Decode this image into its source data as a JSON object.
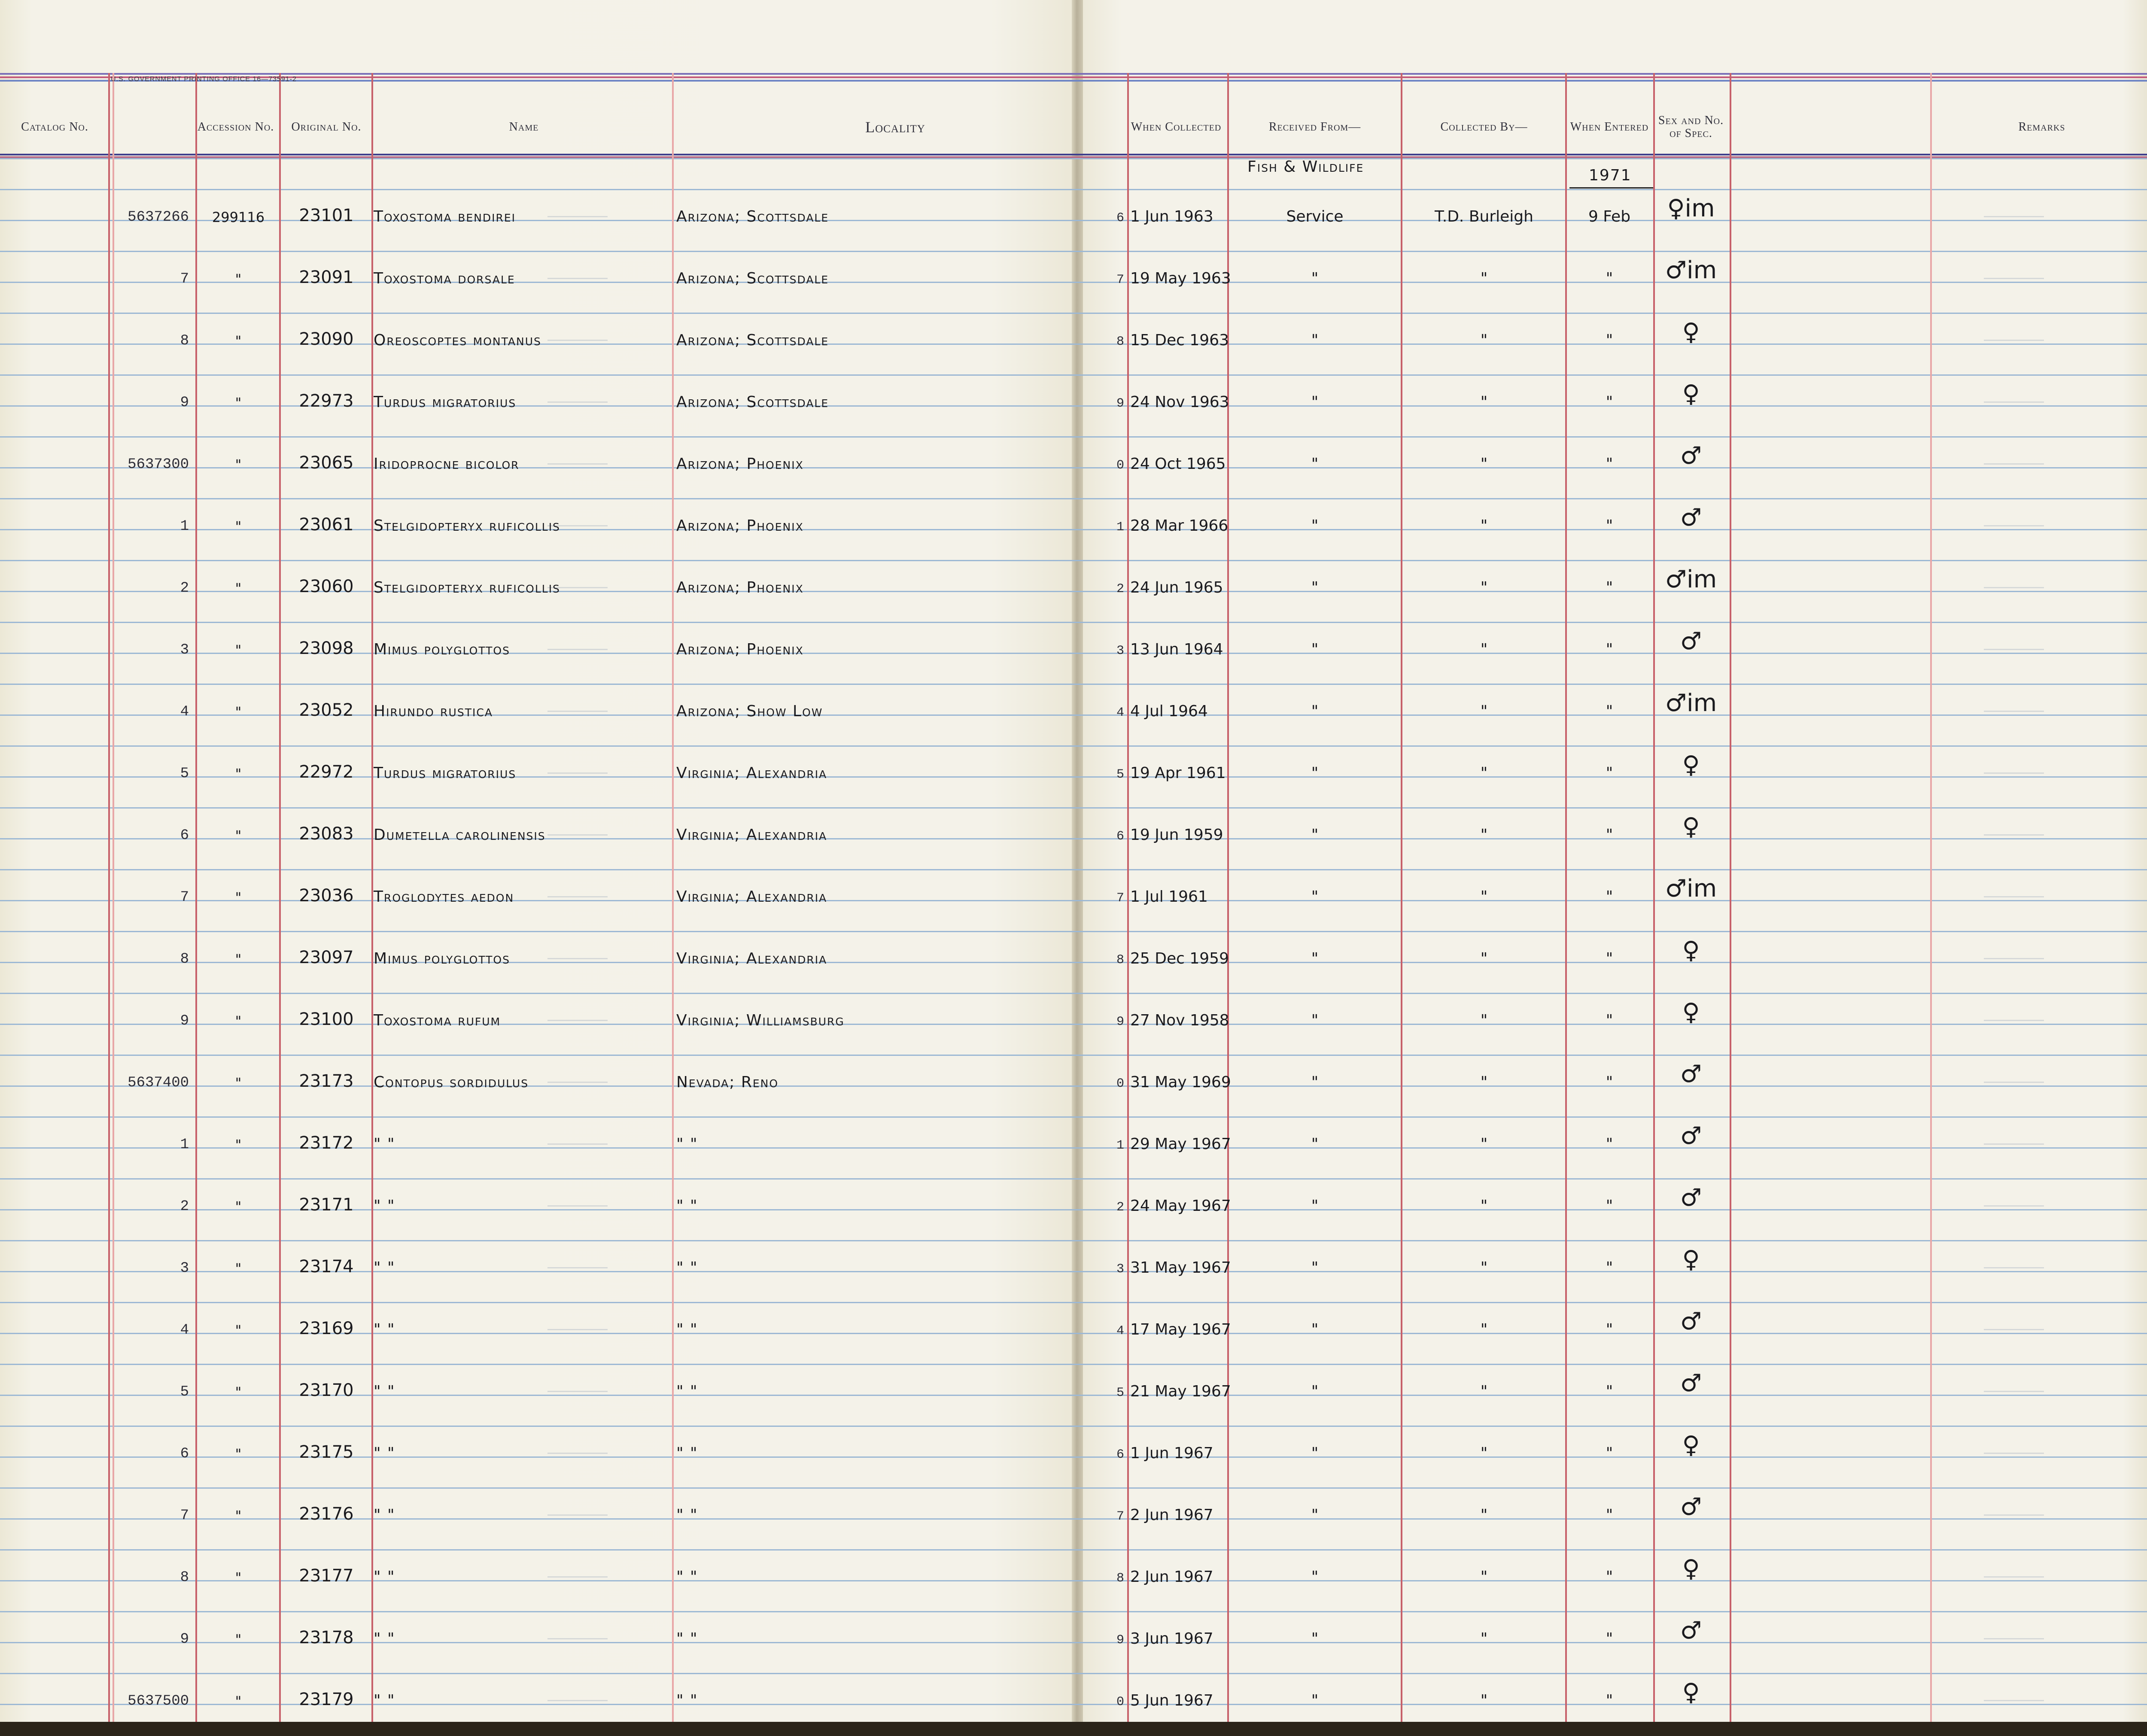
{
  "imprint": "U.S. GOVERNMENT PRINTING OFFICE    16—73591-2",
  "headers": {
    "catalog": "Catalog No.",
    "accession": "Accession No.",
    "original": "Original No.",
    "name": "Name",
    "locality": "Locality",
    "when_collected": "When Collected",
    "received_from": "Received From—",
    "collected_by": "Collected By—",
    "when_entered": "When Entered",
    "sex": "Sex and No. of Spec.",
    "remarks": "Remarks"
  },
  "top_annotations": {
    "received_from": "Fish & Wildlife",
    "entered_year": "1971"
  },
  "rows": [
    {
      "cat": "5637266",
      "acc": "299116",
      "orig": "23101",
      "name": "Toxostoma bendirei",
      "loc": "Arizona; Scottsdale",
      "num": "6",
      "date": "1 Jun 1963",
      "recv": "Service",
      "coll": "T.D. Burleigh",
      "ent": "9 Feb",
      "sex": "♀im"
    },
    {
      "cat": "7",
      "acc": "\"",
      "orig": "23091",
      "name": "Toxostoma dorsale",
      "loc": "Arizona; Scottsdale",
      "num": "7",
      "date": "19 May 1963",
      "recv": "\"",
      "coll": "\"",
      "ent": "\"",
      "sex": "♂im"
    },
    {
      "cat": "8",
      "acc": "\"",
      "orig": "23090",
      "name": "Oreoscoptes montanus",
      "loc": "Arizona; Scottsdale",
      "num": "8",
      "date": "15 Dec 1963",
      "recv": "\"",
      "coll": "\"",
      "ent": "\"",
      "sex": "♀"
    },
    {
      "cat": "9",
      "acc": "\"",
      "orig": "22973",
      "name": "Turdus migratorius",
      "loc": "Arizona; Scottsdale",
      "num": "9",
      "date": "24 Nov 1963",
      "recv": "\"",
      "coll": "\"",
      "ent": "\"",
      "sex": "♀"
    },
    {
      "cat": "5637300",
      "acc": "\"",
      "orig": "23065",
      "name": "Iridoprocne bicolor",
      "loc": "Arizona; Phoenix",
      "num": "0",
      "date": "24 Oct 1965",
      "recv": "\"",
      "coll": "\"",
      "ent": "\"",
      "sex": "♂"
    },
    {
      "cat": "1",
      "acc": "\"",
      "orig": "23061",
      "name": "Stelgidopteryx ruficollis",
      "loc": "Arizona; Phoenix",
      "num": "1",
      "date": "28 Mar 1966",
      "recv": "\"",
      "coll": "\"",
      "ent": "\"",
      "sex": "♂"
    },
    {
      "cat": "2",
      "acc": "\"",
      "orig": "23060",
      "name": "Stelgidopteryx ruficollis",
      "loc": "Arizona; Phoenix",
      "num": "2",
      "date": "24 Jun 1965",
      "recv": "\"",
      "coll": "\"",
      "ent": "\"",
      "sex": "♂im"
    },
    {
      "cat": "3",
      "acc": "\"",
      "orig": "23098",
      "name": "Mimus polyglottos",
      "loc": "Arizona; Phoenix",
      "num": "3",
      "date": "13 Jun 1964",
      "recv": "\"",
      "coll": "\"",
      "ent": "\"",
      "sex": "♂"
    },
    {
      "cat": "4",
      "acc": "\"",
      "orig": "23052",
      "name": "Hirundo rustica",
      "loc": "Arizona; Show Low",
      "num": "4",
      "date": "4 Jul 1964",
      "recv": "\"",
      "coll": "\"",
      "ent": "\"",
      "sex": "♂im"
    },
    {
      "cat": "5",
      "acc": "\"",
      "orig": "22972",
      "name": "Turdus migratorius",
      "loc": "Virginia; Alexandria",
      "num": "5",
      "date": "19 Apr 1961",
      "recv": "\"",
      "coll": "\"",
      "ent": "\"",
      "sex": "♀"
    },
    {
      "cat": "6",
      "acc": "\"",
      "orig": "23083",
      "name": "Dumetella carolinensis",
      "loc": "Virginia; Alexandria",
      "num": "6",
      "date": "19 Jun 1959",
      "recv": "\"",
      "coll": "\"",
      "ent": "\"",
      "sex": "♀"
    },
    {
      "cat": "7",
      "acc": "\"",
      "orig": "23036",
      "name": "Troglodytes aedon",
      "loc": "Virginia; Alexandria",
      "num": "7",
      "date": "1 Jul 1961",
      "recv": "\"",
      "coll": "\"",
      "ent": "\"",
      "sex": "♂im"
    },
    {
      "cat": "8",
      "acc": "\"",
      "orig": "23097",
      "name": "Mimus polyglottos",
      "loc": "Virginia; Alexandria",
      "num": "8",
      "date": "25 Dec 1959",
      "recv": "\"",
      "coll": "\"",
      "ent": "\"",
      "sex": "♀"
    },
    {
      "cat": "9",
      "acc": "\"",
      "orig": "23100",
      "name": "Toxostoma rufum",
      "loc": "Virginia; Williamsburg",
      "num": "9",
      "date": "27 Nov 1958",
      "recv": "\"",
      "coll": "\"",
      "ent": "\"",
      "sex": "♀"
    },
    {
      "cat": "5637400",
      "acc": "\"",
      "orig": "23173",
      "name": "Contopus sordidulus",
      "loc": "Nevada; Reno",
      "num": "0",
      "date": "31 May 1969",
      "recv": "\"",
      "coll": "\"",
      "ent": "\"",
      "sex": "♂"
    },
    {
      "cat": "1",
      "acc": "\"",
      "orig": "23172",
      "name": "\"  \"",
      "loc": "\"  \"",
      "num": "1",
      "date": "29 May 1967",
      "recv": "\"",
      "coll": "\"",
      "ent": "\"",
      "sex": "♂"
    },
    {
      "cat": "2",
      "acc": "\"",
      "orig": "23171",
      "name": "\"  \"",
      "loc": "\"  \"",
      "num": "2",
      "date": "24 May 1967",
      "recv": "\"",
      "coll": "\"",
      "ent": "\"",
      "sex": "♂"
    },
    {
      "cat": "3",
      "acc": "\"",
      "orig": "23174",
      "name": "\"  \"",
      "loc": "\"  \"",
      "num": "3",
      "date": "31 May 1967",
      "recv": "\"",
      "coll": "\"",
      "ent": "\"",
      "sex": "♀"
    },
    {
      "cat": "4",
      "acc": "\"",
      "orig": "23169",
      "name": "\"  \"",
      "loc": "\"  \"",
      "num": "4",
      "date": "17 May 1967",
      "recv": "\"",
      "coll": "\"",
      "ent": "\"",
      "sex": "♂"
    },
    {
      "cat": "5",
      "acc": "\"",
      "orig": "23170",
      "name": "\"  \"",
      "loc": "\"  \"",
      "num": "5",
      "date": "21 May 1967",
      "recv": "\"",
      "coll": "\"",
      "ent": "\"",
      "sex": "♂"
    },
    {
      "cat": "6",
      "acc": "\"",
      "orig": "23175",
      "name": "\"  \"",
      "loc": "\"  \"",
      "num": "6",
      "date": "1 Jun 1967",
      "recv": "\"",
      "coll": "\"",
      "ent": "\"",
      "sex": "♀"
    },
    {
      "cat": "7",
      "acc": "\"",
      "orig": "23176",
      "name": "\"  \"",
      "loc": "\"  \"",
      "num": "7",
      "date": "2 Jun 1967",
      "recv": "\"",
      "coll": "\"",
      "ent": "\"",
      "sex": "♂"
    },
    {
      "cat": "8",
      "acc": "\"",
      "orig": "23177",
      "name": "\"  \"",
      "loc": "\"  \"",
      "num": "8",
      "date": "2 Jun 1967",
      "recv": "\"",
      "coll": "\"",
      "ent": "\"",
      "sex": "♀"
    },
    {
      "cat": "9",
      "acc": "\"",
      "orig": "23178",
      "name": "\"  \"",
      "loc": "\"  \"",
      "num": "9",
      "date": "3 Jun 1967",
      "recv": "\"",
      "coll": "\"",
      "ent": "\"",
      "sex": "♂"
    },
    {
      "cat": "5637500",
      "acc": "\"",
      "orig": "23179",
      "name": "\"  \"",
      "loc": "\"  \"",
      "num": "0",
      "date": "5 Jun 1967",
      "recv": "\"",
      "coll": "\"",
      "ent": "\"",
      "sex": "♀"
    }
  ],
  "colors": {
    "paper": "#f3f1e6",
    "rule_blue": "#9cb8d4",
    "rule_red": "#c7616a",
    "ink": "#1a1a1e"
  }
}
